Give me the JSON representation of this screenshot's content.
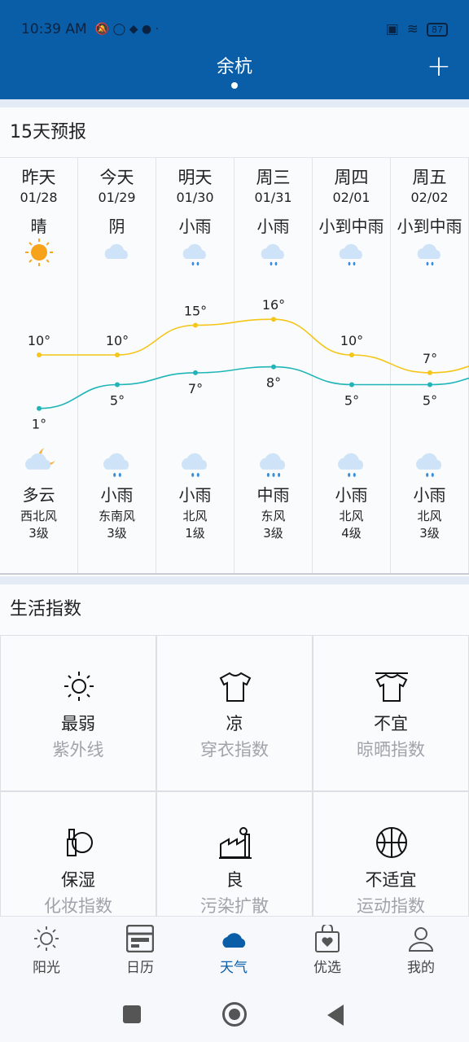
{
  "status": {
    "time": "10:39 AM",
    "battery": "87"
  },
  "header": {
    "city": "余杭",
    "add_label": "+"
  },
  "forecast": {
    "title": "15天预报",
    "days": [
      {
        "day": "昨天",
        "date": "01/28",
        "cond": "晴",
        "icon": "sun",
        "high": 10,
        "low": 1,
        "night_cond": "多云",
        "night_icon": "partly-cloudy-night",
        "wind": "西北风",
        "level": "3级"
      },
      {
        "day": "今天",
        "date": "01/29",
        "cond": "阴",
        "icon": "cloud",
        "high": 10,
        "low": 5,
        "night_cond": "小雨",
        "night_icon": "light-rain",
        "wind": "东南风",
        "level": "3级"
      },
      {
        "day": "明天",
        "date": "01/30",
        "cond": "小雨",
        "icon": "light-rain",
        "high": 15,
        "low": 7,
        "night_cond": "小雨",
        "night_icon": "light-rain",
        "wind": "北风",
        "level": "1级"
      },
      {
        "day": "周三",
        "date": "01/31",
        "cond": "小雨",
        "icon": "light-rain",
        "high": 16,
        "low": 8,
        "night_cond": "中雨",
        "night_icon": "moderate-rain",
        "wind": "东风",
        "level": "3级"
      },
      {
        "day": "周四",
        "date": "02/01",
        "cond": "小到中雨",
        "icon": "light-rain",
        "high": 10,
        "low": 5,
        "night_cond": "小雨",
        "night_icon": "light-rain",
        "wind": "北风",
        "level": "4级"
      },
      {
        "day": "周五",
        "date": "02/02",
        "cond": "小到中雨",
        "icon": "light-rain",
        "high": 7,
        "low": 5,
        "night_cond": "小雨",
        "night_icon": "light-rain",
        "wind": "北风",
        "level": "3级"
      }
    ],
    "high_color": "#f5c518",
    "low_color": "#1fb5b8"
  },
  "life": {
    "title": "生活指数",
    "items": [
      {
        "value": "最弱",
        "label": "紫外线",
        "icon": "sun-outline"
      },
      {
        "value": "凉",
        "label": "穿衣指数",
        "icon": "tshirt"
      },
      {
        "value": "不宜",
        "label": "晾晒指数",
        "icon": "tshirt-hanger"
      },
      {
        "value": "保湿",
        "label": "化妆指数",
        "icon": "cosmetics"
      },
      {
        "value": "良",
        "label": "污染扩散",
        "icon": "factory"
      },
      {
        "value": "不适宜",
        "label": "运动指数",
        "icon": "basketball"
      }
    ]
  },
  "nav": {
    "items": [
      {
        "label": "阳光",
        "icon": "sun"
      },
      {
        "label": "日历",
        "icon": "calendar"
      },
      {
        "label": "天气",
        "icon": "cloud",
        "active": true
      },
      {
        "label": "优选",
        "icon": "shopping-bag"
      },
      {
        "label": "我的",
        "icon": "user"
      }
    ],
    "accent": "#0a5ea8"
  }
}
